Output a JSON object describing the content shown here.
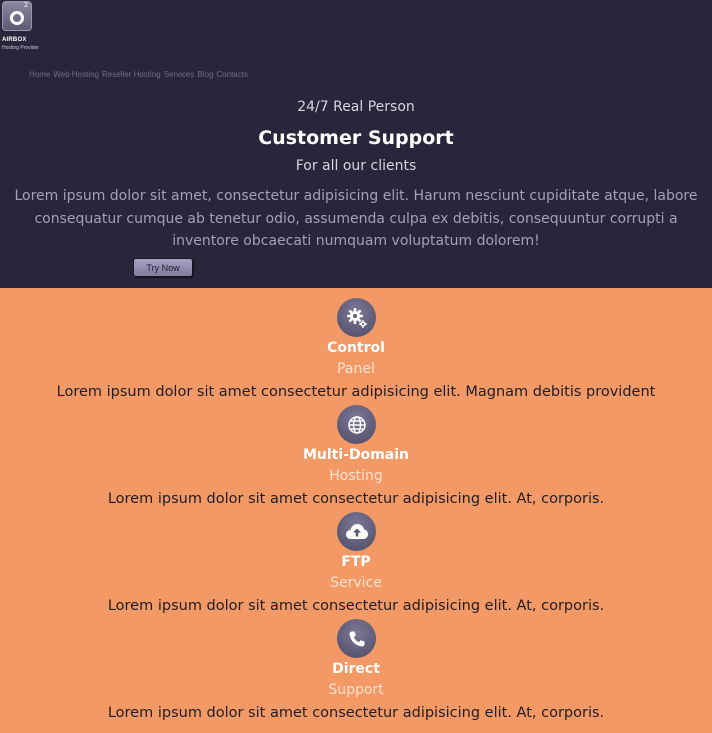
{
  "brand": {
    "logo_letter": "O",
    "logo_superscript": "2",
    "name": "AIRBOX",
    "tagline": "Hosting Provider"
  },
  "nav": [
    "Home",
    "Web Hosting",
    "Reseller Hosting",
    "Services",
    "Blog",
    "Contacts"
  ],
  "hero": {
    "line1": "24/7 Real Person",
    "title": "Customer Support",
    "line3": "For all our clients",
    "paragraph": "Lorem ipsum dolor sit amet, consectetur adipisicing elit. Harum nesciunt cupiditate atque, labore consequatur cumque ab tenetur odio, assumenda culpa ex debitis, consequuntur corrupti a inventore obcaecati numquam voluptatum dolorem!",
    "button_label": "Try Now"
  },
  "features": [
    {
      "icon": "gears-icon",
      "title": "Control",
      "subtitle": "Panel",
      "description": "Lorem ipsum dolor sit amet consectetur adipisicing elit. Magnam debitis provident"
    },
    {
      "icon": "globe-icon",
      "title": "Multi-Domain",
      "subtitle": "Hosting",
      "description": "Lorem ipsum dolor sit amet consectetur adipisicing elit. At, corporis."
    },
    {
      "icon": "cloud-upload-icon",
      "title": "FTP",
      "subtitle": "Service",
      "description": "Lorem ipsum dolor sit amet consectetur adipisicing elit. At, corporis."
    },
    {
      "icon": "phone-icon",
      "title": "Direct",
      "subtitle": "Support",
      "description": "Lorem ipsum dolor sit amet consectetur adipisicing elit. At, corporis."
    }
  ],
  "colors": {
    "hero_background": "#28263a",
    "page_background": "#f29965",
    "icon_circle": "#5b5874",
    "button": "#8f8bad"
  }
}
